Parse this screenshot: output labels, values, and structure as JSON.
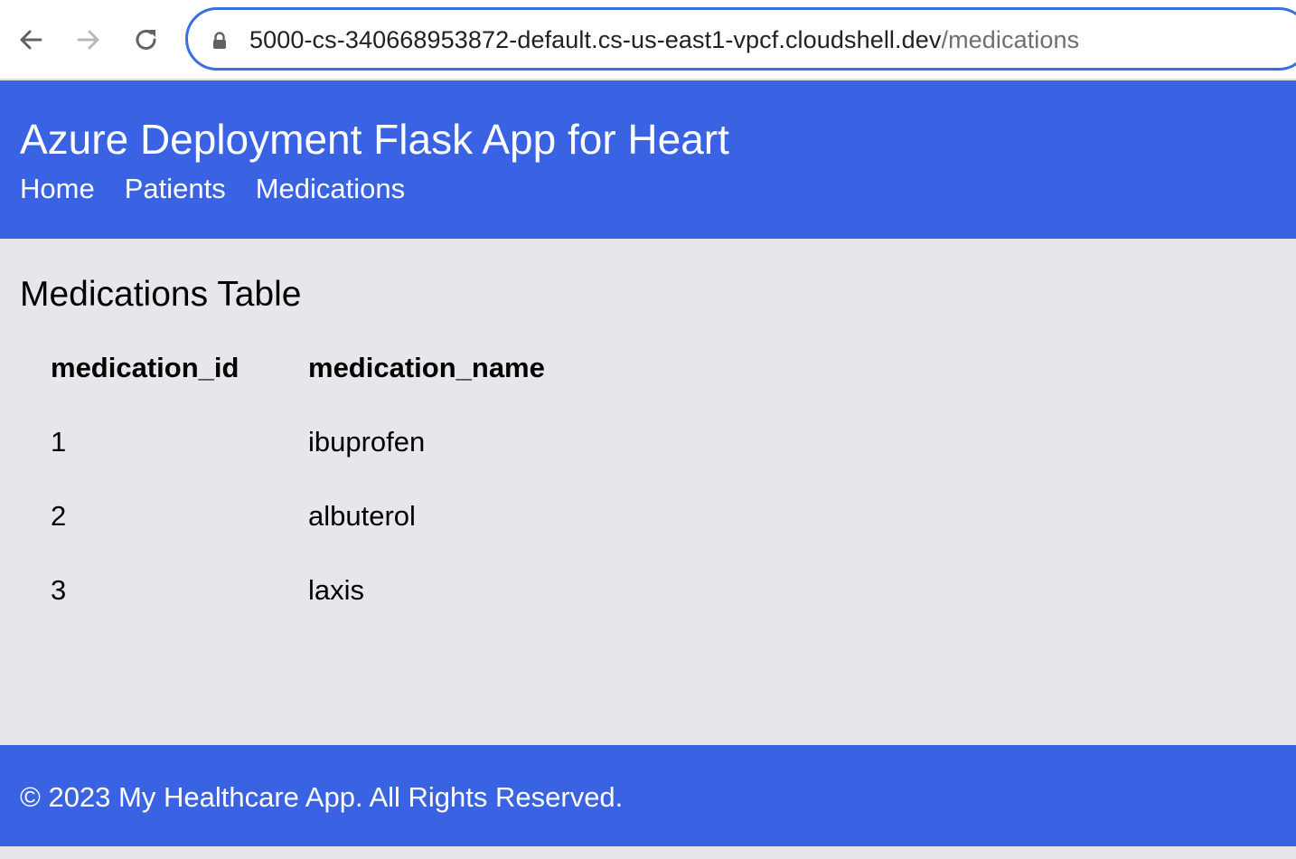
{
  "browser": {
    "url_host": "5000-cs-340668953872-default.cs-us-east1-vpcf.cloudshell.dev",
    "url_path": "/medications",
    "icons": {
      "back": "arrow-left-icon",
      "forward": "arrow-right-icon",
      "reload": "reload-icon",
      "lock": "lock-icon"
    }
  },
  "header": {
    "title": "Azure Deployment Flask App for Heart",
    "nav": [
      {
        "label": "Home"
      },
      {
        "label": "Patients"
      },
      {
        "label": "Medications"
      }
    ],
    "background_color": "#3a63e4"
  },
  "main": {
    "section_title": "Medications Table",
    "table": {
      "columns": [
        "medication_id",
        "medication_name"
      ],
      "rows": [
        [
          "1",
          "ibuprofen"
        ],
        [
          "2",
          "albuterol"
        ],
        [
          "3",
          "laxis"
        ]
      ]
    }
  },
  "footer": {
    "text": "© 2023 My Healthcare App. All Rights Reserved."
  }
}
